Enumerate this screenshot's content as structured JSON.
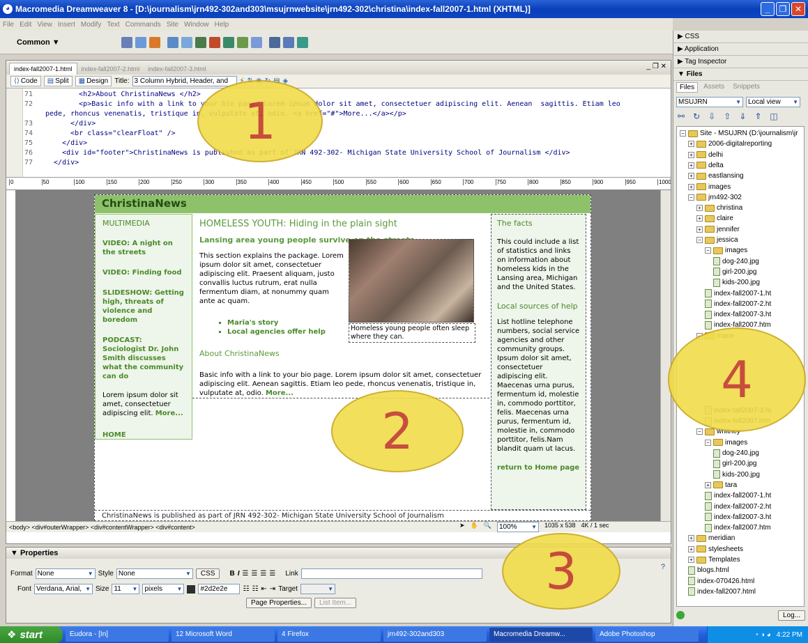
{
  "window": {
    "title": "Macromedia Dreamweaver 8 - [D:\\journalism\\jrn492-302and303\\msujrnwebsite\\jrn492-302\\christina\\index-fall2007-1.html (XHTML)]"
  },
  "menu": [
    "File",
    "Edit",
    "View",
    "Insert",
    "Modify",
    "Text",
    "Commands",
    "Site",
    "Window",
    "Help"
  ],
  "insert_bar": {
    "category": "Common"
  },
  "doc_tabs": [
    "index-fall2007-1.html",
    "index-fall2007-2.html",
    "index-fall2007-3.html"
  ],
  "doc_toolbar": {
    "code": "Code",
    "split": "Split",
    "design": "Design",
    "title_label": "Title:",
    "title_value": "3 Column Hybrid, Header, and"
  },
  "code": {
    "line_numbers": [
      "71",
      "72",
      "",
      "73",
      "74",
      "75",
      "76",
      "77"
    ],
    "lines": [
      "        <h2>About ChristinaNews </h2>",
      "        <p>Basic info with a link to your bio page. Lorem ipsum dolor sit amet, consectetuer adipiscing elit. Aenean  sagittis. Etiam leo",
      "pede, rhoncus venenatis, tristique in, vulputate at, odio. <a href=\"#\">More...</a></p>",
      "      </div>",
      "      <br class=\"clearFloat\" />",
      "    </div>",
      "    <div id=\"footer\">ChristinaNews is published as part of JRN 492-302- Michigan State University School of Journalism </div>",
      "  </div>"
    ]
  },
  "ruler_ticks": [
    "0",
    "50",
    "100",
    "150",
    "200",
    "250",
    "300",
    "350",
    "400",
    "450",
    "500",
    "550",
    "600",
    "650",
    "700",
    "750",
    "800",
    "850",
    "900",
    "950",
    "1000"
  ],
  "design": {
    "brand": "ChristinaNews",
    "left": {
      "heading": "MULTIMEDIA",
      "links": [
        "VIDEO: A night on the streets",
        "VIDEO: Finding food",
        "SLIDESHOW: Getting high, threats of violence and boredom",
        "PODCAST: Sociologist Dr. John Smith discusses what the community can do"
      ],
      "text": "Lorem ipsum dolor sit amet, consectetuer adipiscing elit.",
      "more": "More...",
      "home": "HOME"
    },
    "main": {
      "headline": "HOMELESS YOUTH: Hiding in the plain sight",
      "subhead": "Lansing area young people survive on the streets",
      "body": "This section explains the package. Lorem ipsum dolor sit amet, consectetuer adipiscing elit. Praesent aliquam, justo convallis luctus rutrum, erat nulla fermentum diam, at nonummy quam ante ac quam.",
      "bullets": [
        "Maria's story",
        "Local agencies offer help"
      ],
      "caption": "Homeless young people often sleep where they can.",
      "about_heading": "About ChristinaNews",
      "about_text": "Basic info with a link to your bio page. Lorem ipsum dolor sit amet, consectetuer adipiscing elit. Aenean sagittis. Etiam leo pede, rhoncus venenatis, tristique in, vulputate at, odio.",
      "about_more": "More..."
    },
    "right": {
      "facts_heading": "The facts",
      "facts_text": "This could include a list of statistics and links on information about homeless kids in the Lansing area, Michigan and the United States.",
      "sources_heading": "Local sources of help",
      "sources_text": "List hotline telephone numbers, social service agencies and other community groups. Ipsum dolor sit amet, consectetuer adipiscing elit. Maecenas urna purus, fermentum id, molestie in, commodo porttitor, felis. Maecenas urna purus, fermentum id, molestie in, commodo porttitor, felis.Nam blandit quam ut lacus.",
      "return": "return to Home page"
    },
    "footer": "ChristinaNews is published as part of JRN 492-302- Michigan State University School of Journalism"
  },
  "status": {
    "tags": "<body> <div#outerWrapper> <div#contentWrapper> <div#content>",
    "zoom": "100%",
    "size": "1035 x 538",
    "weight": "4K / 1 sec"
  },
  "properties": {
    "header": "Properties",
    "format_label": "Format",
    "format": "None",
    "style_label": "Style",
    "style": "None",
    "css": "CSS",
    "link_label": "Link",
    "font_label": "Font",
    "font": "Verdana, Arial,",
    "size_label": "Size",
    "size": "11",
    "unit": "pixels",
    "color": "#2d2e2e",
    "target_label": "Target",
    "page_props": "Page Properties...",
    "list_item": "List Item..."
  },
  "panels": {
    "css": "CSS",
    "application": "Application",
    "tag_inspector": "Tag Inspector",
    "files": "Files",
    "tabs": [
      "Files",
      "Assets",
      "Snippets"
    ],
    "site": "MSUJRN",
    "view": "Local view"
  },
  "tree": [
    {
      "d": 0,
      "t": "Site - MSUJRN (D:\\journalism\\jr",
      "k": "f",
      "pm": "-"
    },
    {
      "d": 1,
      "t": "2006-digitalreporting",
      "k": "f",
      "pm": "+"
    },
    {
      "d": 1,
      "t": "delhi",
      "k": "f",
      "pm": "+"
    },
    {
      "d": 1,
      "t": "delta",
      "k": "f",
      "pm": "+"
    },
    {
      "d": 1,
      "t": "eastlansing",
      "k": "f",
      "pm": "+"
    },
    {
      "d": 1,
      "t": "images",
      "k": "f",
      "pm": "+"
    },
    {
      "d": 1,
      "t": "jrn492-302",
      "k": "f",
      "pm": "-"
    },
    {
      "d": 2,
      "t": "christina",
      "k": "f",
      "pm": "+"
    },
    {
      "d": 2,
      "t": "claire",
      "k": "f",
      "pm": "+"
    },
    {
      "d": 2,
      "t": "jennifer",
      "k": "f",
      "pm": "+"
    },
    {
      "d": 2,
      "t": "jessica",
      "k": "f",
      "pm": "-"
    },
    {
      "d": 3,
      "t": "images",
      "k": "f",
      "pm": "-"
    },
    {
      "d": 4,
      "t": "dog-240.jpg",
      "k": "i"
    },
    {
      "d": 4,
      "t": "girl-200.jpg",
      "k": "i"
    },
    {
      "d": 4,
      "t": "kids-200.jpg",
      "k": "i"
    },
    {
      "d": 3,
      "t": "index-fall2007-1.ht",
      "k": "h"
    },
    {
      "d": 3,
      "t": "index-fall2007-2.ht",
      "k": "h"
    },
    {
      "d": 3,
      "t": "index-fall2007-3.ht",
      "k": "h"
    },
    {
      "d": 3,
      "t": "index-fall2007.htm",
      "k": "h"
    },
    {
      "d": 2,
      "t": "marie",
      "k": "f",
      "pm": "-"
    },
    {
      "d": 3,
      "t": "",
      "k": "x"
    },
    {
      "d": 3,
      "t": "",
      "k": "x"
    },
    {
      "d": 3,
      "t": "",
      "k": "x"
    },
    {
      "d": 3,
      "t": "",
      "k": "x"
    },
    {
      "d": 3,
      "t": "",
      "k": "x"
    },
    {
      "d": 3,
      "t": "",
      "k": "x"
    },
    {
      "d": 3,
      "t": "index-fall2007-3.ht",
      "k": "h"
    },
    {
      "d": 3,
      "t": "index-fall2007.htm",
      "k": "h"
    },
    {
      "d": 2,
      "t": "whitney",
      "k": "f",
      "pm": "-"
    },
    {
      "d": 3,
      "t": "images",
      "k": "f",
      "pm": "-"
    },
    {
      "d": 4,
      "t": "dog-240.jpg",
      "k": "i"
    },
    {
      "d": 4,
      "t": "girl-200.jpg",
      "k": "i"
    },
    {
      "d": 4,
      "t": "kids-200.jpg",
      "k": "i"
    },
    {
      "d": 3,
      "t": "tara",
      "k": "f",
      "pm": "+"
    },
    {
      "d": 3,
      "t": "index-fall2007-1.ht",
      "k": "h"
    },
    {
      "d": 3,
      "t": "index-fall2007-2.ht",
      "k": "h"
    },
    {
      "d": 3,
      "t": "index-fall2007-3.ht",
      "k": "h"
    },
    {
      "d": 3,
      "t": "index-fall2007.htm",
      "k": "h"
    },
    {
      "d": 1,
      "t": "meridian",
      "k": "f",
      "pm": "+"
    },
    {
      "d": 1,
      "t": "stylesheets",
      "k": "f",
      "pm": "+"
    },
    {
      "d": 1,
      "t": "Templates",
      "k": "f",
      "pm": "+"
    },
    {
      "d": 1,
      "t": "blogs.html",
      "k": "h"
    },
    {
      "d": 1,
      "t": "index-070426.html",
      "k": "h"
    },
    {
      "d": 1,
      "t": "index-fall2007.html",
      "k": "h"
    }
  ],
  "log_button": "Log...",
  "taskbar": {
    "start": "start",
    "tasks": [
      "Eudora - [In]",
      "12 Microsoft Word",
      "4 Firefox",
      "jrn492-302and303",
      "Macromedia Dreamw...",
      "Adobe Photoshop"
    ],
    "clock": "4:22 PM"
  },
  "callouts": [
    "1",
    "2",
    "3",
    "4"
  ],
  "colors": {
    "brand_green": "#8dc26a",
    "link_green": "#4a8a2a",
    "callout_fill": "#f1dc4a",
    "callout_text": "#c13a2a"
  }
}
